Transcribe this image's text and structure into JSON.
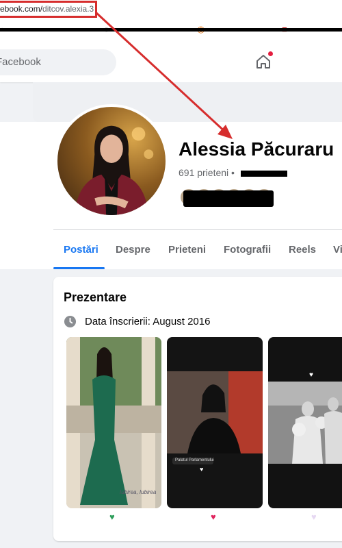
{
  "browser": {
    "url_domain": "ebook.com/",
    "url_path": "ditcov.alexia.3"
  },
  "header": {
    "search_placeholder": "Facebook"
  },
  "profile": {
    "name": "Alessia Păcuraru",
    "friends": "691 prieteni •"
  },
  "tabs": [
    {
      "label": "Postări",
      "active": true
    },
    {
      "label": "Despre"
    },
    {
      "label": "Prieteni"
    },
    {
      "label": "Fotografii"
    },
    {
      "label": "Reels"
    },
    {
      "label": "Vi"
    }
  ],
  "intro": {
    "title": "Prezentare",
    "join_date": "Data înscrierii: August 2016"
  },
  "photos": [
    {
      "subject": "woman in green gown",
      "caption": "Iubirea, Iubirea"
    },
    {
      "subject": "woman in black coat",
      "caption": "Palatul Parlamentului"
    },
    {
      "subject": "black and white wedding"
    }
  ],
  "reactions": [
    "green-heart",
    "red-heart",
    "white-heart"
  ],
  "colors": {
    "facebook_blue": "#1877f2",
    "annotation_red": "#d62d2d",
    "page_background": "#f0f2f5"
  }
}
